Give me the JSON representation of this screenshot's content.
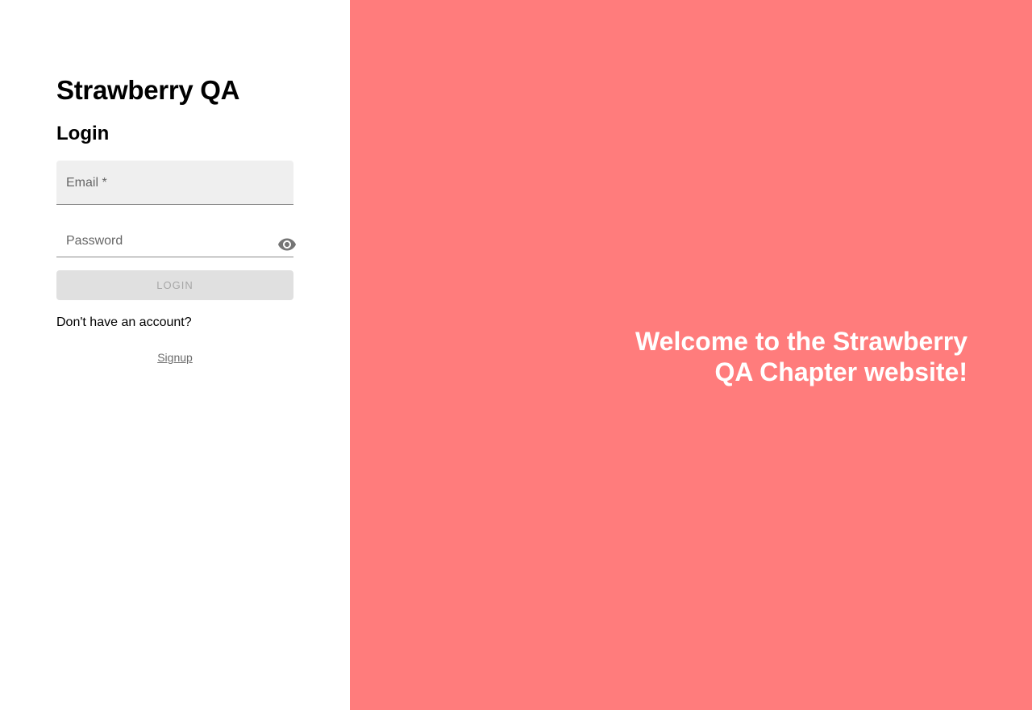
{
  "app": {
    "title": "Strawberry QA"
  },
  "login_form": {
    "heading": "Login",
    "email": {
      "label": "Email *",
      "value": ""
    },
    "password": {
      "label": "Password",
      "value": "",
      "toggle_icon": "eye-icon"
    },
    "submit_label": "LOGIN",
    "submit_enabled": false,
    "account_prompt": "Don't have an account?",
    "signup_label": "Signup"
  },
  "hero": {
    "message": "Welcome to the Strawberry QA Chapter website!",
    "background_color": "#ff7c7c",
    "text_color": "#ffffff"
  }
}
